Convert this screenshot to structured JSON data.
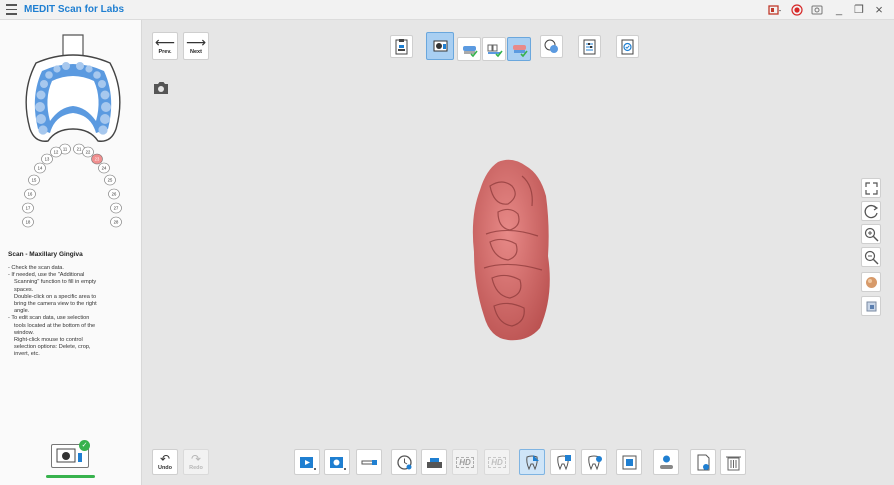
{
  "app": {
    "title": "MEDIT Scan for Labs"
  },
  "window_controls": {
    "minimize": "_",
    "restore": "❐",
    "close": "×"
  },
  "nav": {
    "prev_label": "Prev.",
    "next_label": "Next"
  },
  "sidebar": {
    "teeth_numbers": [
      "11",
      "12",
      "13",
      "14",
      "15",
      "16",
      "17",
      "18",
      "21",
      "22",
      "23",
      "24",
      "25",
      "26",
      "27",
      "28"
    ],
    "selected_tooth": "23",
    "instructions_title": "Scan - Maxillary Gingiva",
    "instructions": [
      "- Check the scan data.",
      "- If needed, use the \"Additional\nScanning\" function to fill in empty\nspaces.\nDouble-click on a specific area to\nbring the camera view to the right\nangle.",
      "- To edit scan data, use selection\ntools located at the bottom of the\nwindow.\nRight-click mouse to control\nselection options: Delete, crop,\ninvert, etc."
    ]
  },
  "bottom": {
    "undo_label": "Undo",
    "redo_label": "Redo",
    "hd_label": "HD"
  },
  "colors": {
    "accent": "#1f7fd1",
    "scan": "#d9706f",
    "selected_tooth": "#f08e8e",
    "check": "#37b24d"
  }
}
